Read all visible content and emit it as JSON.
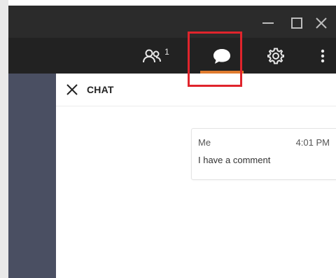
{
  "participants": {
    "count": "1"
  },
  "chat": {
    "title": "CHAT",
    "messages": [
      {
        "sender": "Me",
        "time": "4:01 PM",
        "text": "I have a comment"
      }
    ]
  },
  "colors": {
    "titlebar": "#2b2b2b",
    "toolbar": "#222222",
    "accent": "#e07b2e",
    "highlight": "#e0242c",
    "side_rail": "#4a4f62"
  },
  "icons": [
    "minimize-icon",
    "maximize-icon",
    "close-window-icon",
    "participants-icon",
    "chat-bubble-icon",
    "gear-icon",
    "more-vertical-icon",
    "close-icon"
  ]
}
